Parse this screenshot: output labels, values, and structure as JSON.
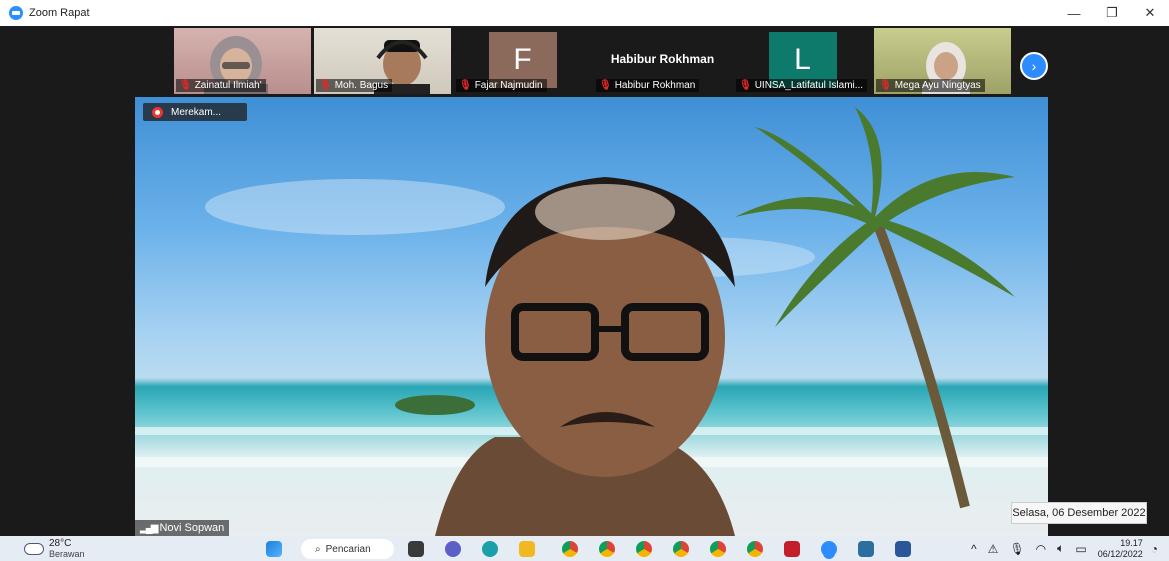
{
  "window": {
    "title": "Zoom Rapat",
    "controls": [
      "—",
      "❐",
      "✕"
    ]
  },
  "participants": [
    {
      "name": "Zainatul Ilmiah'",
      "kind": "video",
      "bg": "#c9a3a0"
    },
    {
      "name": "Moh. Bagus",
      "kind": "video",
      "bg": "#d8d2c6"
    },
    {
      "name": "Fajar Najmudin",
      "kind": "letter",
      "letter": "F",
      "bg": "#8b6a5c"
    },
    {
      "name": "Habibur Rokhman",
      "kind": "text",
      "bg": "#1a1a1a"
    },
    {
      "name": "UINSA_Latifatul Islami...",
      "kind": "letter",
      "letter": "L",
      "bg": "#0e7a6c"
    },
    {
      "name": "Mega Ayu Ningtyas",
      "kind": "video",
      "bg": "#b5ba7a"
    }
  ],
  "main_video": {
    "recording_label": "Merekam...",
    "speaker_name": "Novi Sopwan"
  },
  "overlay": {
    "date_tooltip": "Selasa, 06 Desember 2022"
  },
  "taskbar": {
    "weather_temp": "28°C",
    "weather_desc": "Berawan",
    "search_placeholder": "Pencarian",
    "time": "19.17",
    "date": "06/12/2022",
    "app_icons": [
      {
        "name": "start",
        "color": "#1e7fd8"
      },
      {
        "name": "task-view",
        "color": "#444"
      },
      {
        "name": "chat",
        "color": "#5b5fc7"
      },
      {
        "name": "edge",
        "color": "#1aa0a8"
      },
      {
        "name": "file-explorer",
        "color": "#f2b824"
      },
      {
        "name": "chrome-1",
        "color": "#dd4b39"
      },
      {
        "name": "chrome-2",
        "color": "#dd4b39"
      },
      {
        "name": "chrome-3",
        "color": "#dd4b39"
      },
      {
        "name": "chrome-4",
        "color": "#dd4b39"
      },
      {
        "name": "chrome-5",
        "color": "#dd4b39"
      },
      {
        "name": "chrome-6",
        "color": "#dd4b39"
      },
      {
        "name": "mendeley",
        "color": "#c41e2a"
      },
      {
        "name": "zoom",
        "color": "#2d8cff"
      },
      {
        "name": "camera",
        "color": "#2a6f9e"
      },
      {
        "name": "word",
        "color": "#2b579a"
      }
    ]
  }
}
